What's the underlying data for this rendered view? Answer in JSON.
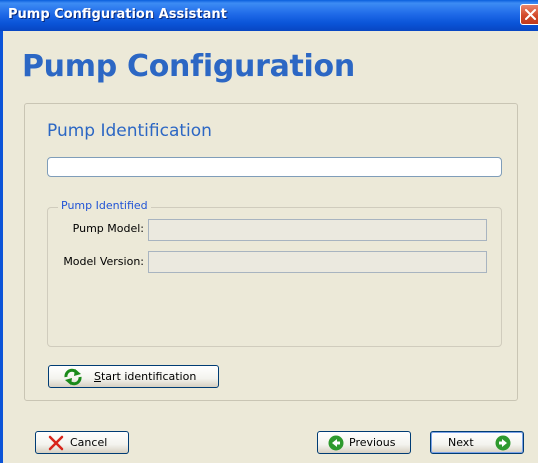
{
  "window": {
    "title": "Pump Configuration Assistant"
  },
  "page": {
    "heading": "Pump Configuration"
  },
  "identification": {
    "section_title": "Pump Identification",
    "input_value": "",
    "group_title": "Pump Identified",
    "fields": [
      {
        "label": "Pump Model:",
        "value": ""
      },
      {
        "label": "Model Version:",
        "value": ""
      }
    ],
    "start_button": {
      "mnemonic": "S",
      "rest": "tart identification",
      "icon": "refresh-arrows-icon"
    }
  },
  "footer": {
    "cancel": {
      "label": "Cancel",
      "icon": "red-x-icon"
    },
    "previous": {
      "label": "Previous",
      "icon": "green-left-arrow-icon"
    },
    "next": {
      "label": "Next",
      "icon": "green-right-arrow-icon"
    }
  },
  "colors": {
    "heading": "#2c67c4",
    "titlebar": "#0a54d8",
    "window_bg": "#ece9d8"
  }
}
